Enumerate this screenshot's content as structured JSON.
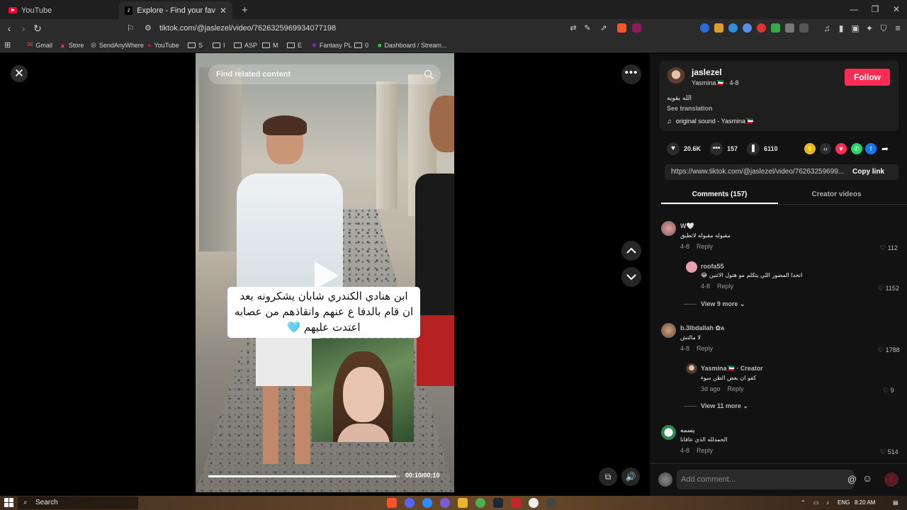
{
  "browser": {
    "tabs": [
      {
        "title": "YouTube",
        "active": false
      },
      {
        "title": "Explore - Find your favourite vid",
        "active": true
      }
    ],
    "url": "tiktok.com/@jaslezel/video/7626325969934077198",
    "bookmarks": [
      "Gmail",
      "Store",
      "SendAnyWhere",
      "YouTube",
      "S",
      "I",
      "ASP",
      "M",
      "E",
      "Fantasy PL",
      "0",
      "Dashboard / Stream..."
    ]
  },
  "video": {
    "search_placeholder": "Find related content",
    "caption": "ابن هنادي الكندري شابان يشكرونه بعد ان قام بالدفا ع عنهم وانقاذهم من عصابه اعتدت عليهم 🩵",
    "caption_line1": "ابن هنادي الكندري شابان يشكرونه بعد",
    "caption_line2": "ان قام بالدفا ع عنهم وانقاذهم من عصابه",
    "caption_line3": "اعتدت عليهم 🩵",
    "time": "00:10/00:10",
    "progress": 0.98
  },
  "author": {
    "username": "jaslezel",
    "display": "Yasmina🇰🇼 · 4-8",
    "description": "الله يقويه",
    "see_translation": "See translation",
    "sound": "original sound - Yasmina🇰🇼",
    "follow_label": "Follow"
  },
  "stats": {
    "likes": "20.6K",
    "comments": "157",
    "saves": "6110"
  },
  "link": {
    "url": "https://www.tiktok.com/@jaslezel/video/76263259699...",
    "copy_label": "Copy link"
  },
  "panel_tabs": {
    "comments": "Comments (157)",
    "creator": "Creator videos"
  },
  "comments": [
    {
      "name": "W🤍",
      "text": "مقبوله مقبوله لاتطبق",
      "date": "4-8",
      "reply": "Reply",
      "likes": "112"
    },
    {
      "name": "roofa55",
      "text": "اتحدا المصور اللي يتكلم مو هتول الاثنين 😂",
      "date": "4-8",
      "reply": "Reply",
      "likes": "1152"
    },
    {
      "view_more": "View 9 more"
    },
    {
      "name": "b.3lbdallah ✿ᴀ",
      "text": "لا مالتش",
      "date": "4-8",
      "reply": "Reply",
      "likes": "1788"
    },
    {
      "name": "Yasmina🇰🇼 · Creator",
      "text": "كفو ان بعض الظن سوء",
      "date": "3d ago",
      "reply": "Reply",
      "likes": "9"
    },
    {
      "view_more": "View 11 more"
    },
    {
      "name": "بسمه",
      "text": "الحمدلله الذي عافانا",
      "date": "4-8",
      "reply": "Reply",
      "likes": "514"
    }
  ],
  "comment_input": {
    "placeholder": "Add comment..."
  },
  "taskbar": {
    "search": "Search",
    "lang": "ENG",
    "time": "8:20 AM"
  },
  "colors": {
    "accent": "#fe2c55",
    "background": "#121212"
  }
}
